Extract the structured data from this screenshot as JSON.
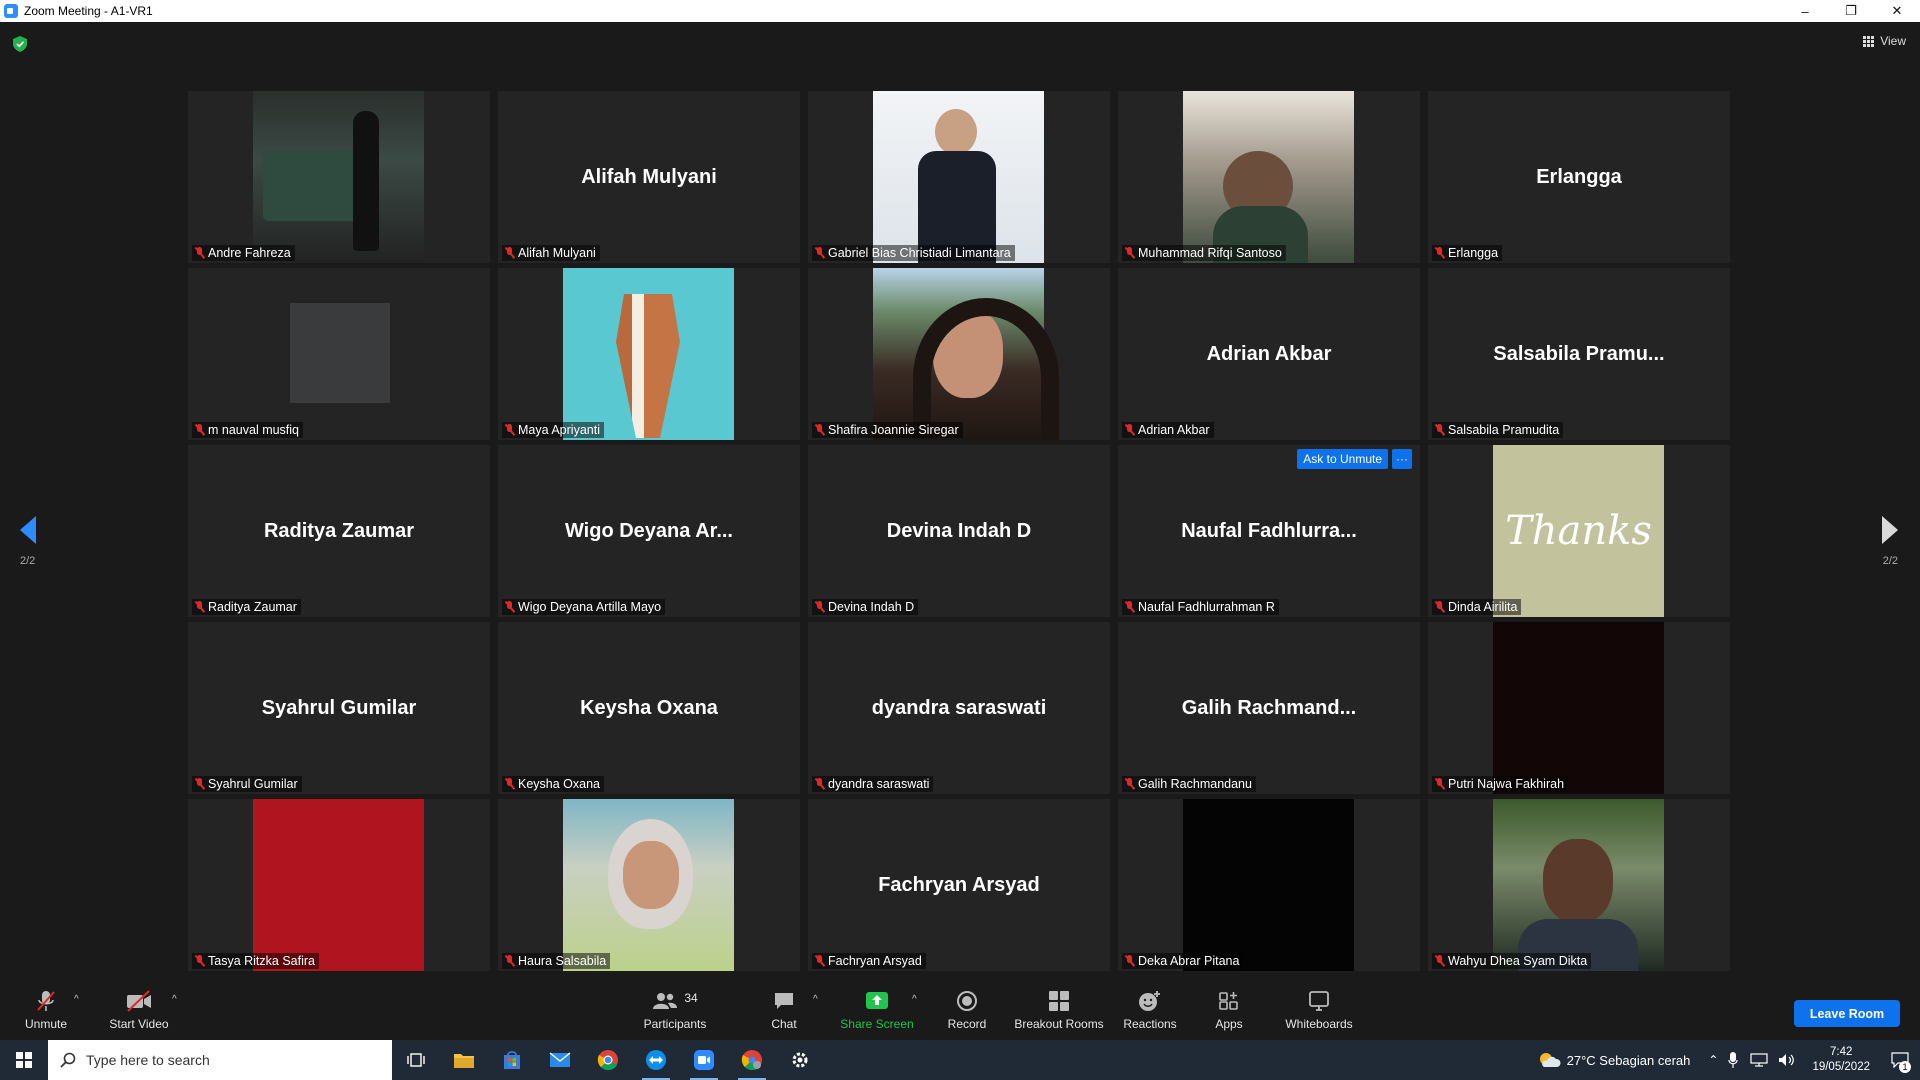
{
  "window": {
    "title": "Zoom Meeting - A1-VR1",
    "minimize": "–",
    "restore": "❐",
    "close": "✕"
  },
  "view_button": {
    "label": "View"
  },
  "tiles": [
    {
      "name": "Andre Fahreza",
      "display": "",
      "video": "andre"
    },
    {
      "name": "Alifah Mulyani",
      "display": "Alifah Mulyani",
      "video": ""
    },
    {
      "name": "Gabriel Bias Christiadi Limantara",
      "display": "",
      "video": "gabriel"
    },
    {
      "name": "Muhammad Rifqi Santoso",
      "display": "",
      "video": "rifqi"
    },
    {
      "name": "Erlangga",
      "display": "Erlangga",
      "video": ""
    },
    {
      "name": "m nauval musfiq",
      "display": "",
      "video": "nauval"
    },
    {
      "name": "Maya Apriyanti",
      "display": "",
      "video": "maya"
    },
    {
      "name": "Shafira Joannie Siregar",
      "display": "",
      "video": "shafira"
    },
    {
      "name": "Adrian Akbar",
      "display": "Adrian Akbar",
      "video": ""
    },
    {
      "name": "Salsabila Pramudita",
      "display": "Salsabila  Pramu...",
      "video": ""
    },
    {
      "name": "Raditya Zaumar",
      "display": "Raditya Zaumar",
      "video": ""
    },
    {
      "name": "Wigo Deyana Artilla Mayo",
      "display": "Wigo  Deyana  Ar...",
      "video": ""
    },
    {
      "name": "Devina Indah D",
      "display": "Devina Indah D",
      "video": ""
    },
    {
      "name": "Naufal Fadhlurrahman R",
      "display": "Naufal  Fadhlurra...",
      "video": "",
      "ask_unmute": "Ask to Unmute",
      "more": "···"
    },
    {
      "name": "Dinda Airilita",
      "display": "",
      "video": "dinda",
      "video_text": "Thanks"
    },
    {
      "name": "Syahrul Gumilar",
      "display": "Syahrul Gumilar",
      "video": ""
    },
    {
      "name": "Keysha Oxana",
      "display": "Keysha Oxana",
      "video": ""
    },
    {
      "name": "dyandra saraswati",
      "display": "dyandra saraswati",
      "video": ""
    },
    {
      "name": "Galih Rachmandanu",
      "display": "Galih  Rachmand...",
      "video": ""
    },
    {
      "name": "Putri Najwa Fakhirah",
      "display": "",
      "video": "putri"
    },
    {
      "name": "Tasya Ritzka Safira",
      "display": "",
      "video": "tasya"
    },
    {
      "name": "Haura Salsabila",
      "display": "",
      "video": "haura"
    },
    {
      "name": "Fachryan Arsyad",
      "display": "Fachryan Arsyad",
      "video": ""
    },
    {
      "name": "Deka Abrar Pitana",
      "display": "",
      "video": "deka"
    },
    {
      "name": "Wahyu Dhea Syam Dikta",
      "display": "",
      "video": "wahyu"
    }
  ],
  "pagination": {
    "left": "2/2",
    "right": "2/2"
  },
  "toolbar": {
    "unmute": "Unmute",
    "start_video": "Start Video",
    "participants": "Participants",
    "participants_count": "34",
    "chat": "Chat",
    "share_screen": "Share Screen",
    "record": "Record",
    "breakout_rooms": "Breakout Rooms",
    "reactions": "Reactions",
    "apps": "Apps",
    "whiteboards": "Whiteboards",
    "leave": "Leave Room",
    "caret": "^"
  },
  "taskbar": {
    "search_placeholder": "Type here to search",
    "weather": "27°C  Sebagian cerah",
    "time": "7:42",
    "date": "19/05/2022",
    "notification_count": "1"
  },
  "colors": {
    "zoom_blue": "#0e72ed",
    "share_green": "#21c44c",
    "mute_red": "#e02828"
  }
}
